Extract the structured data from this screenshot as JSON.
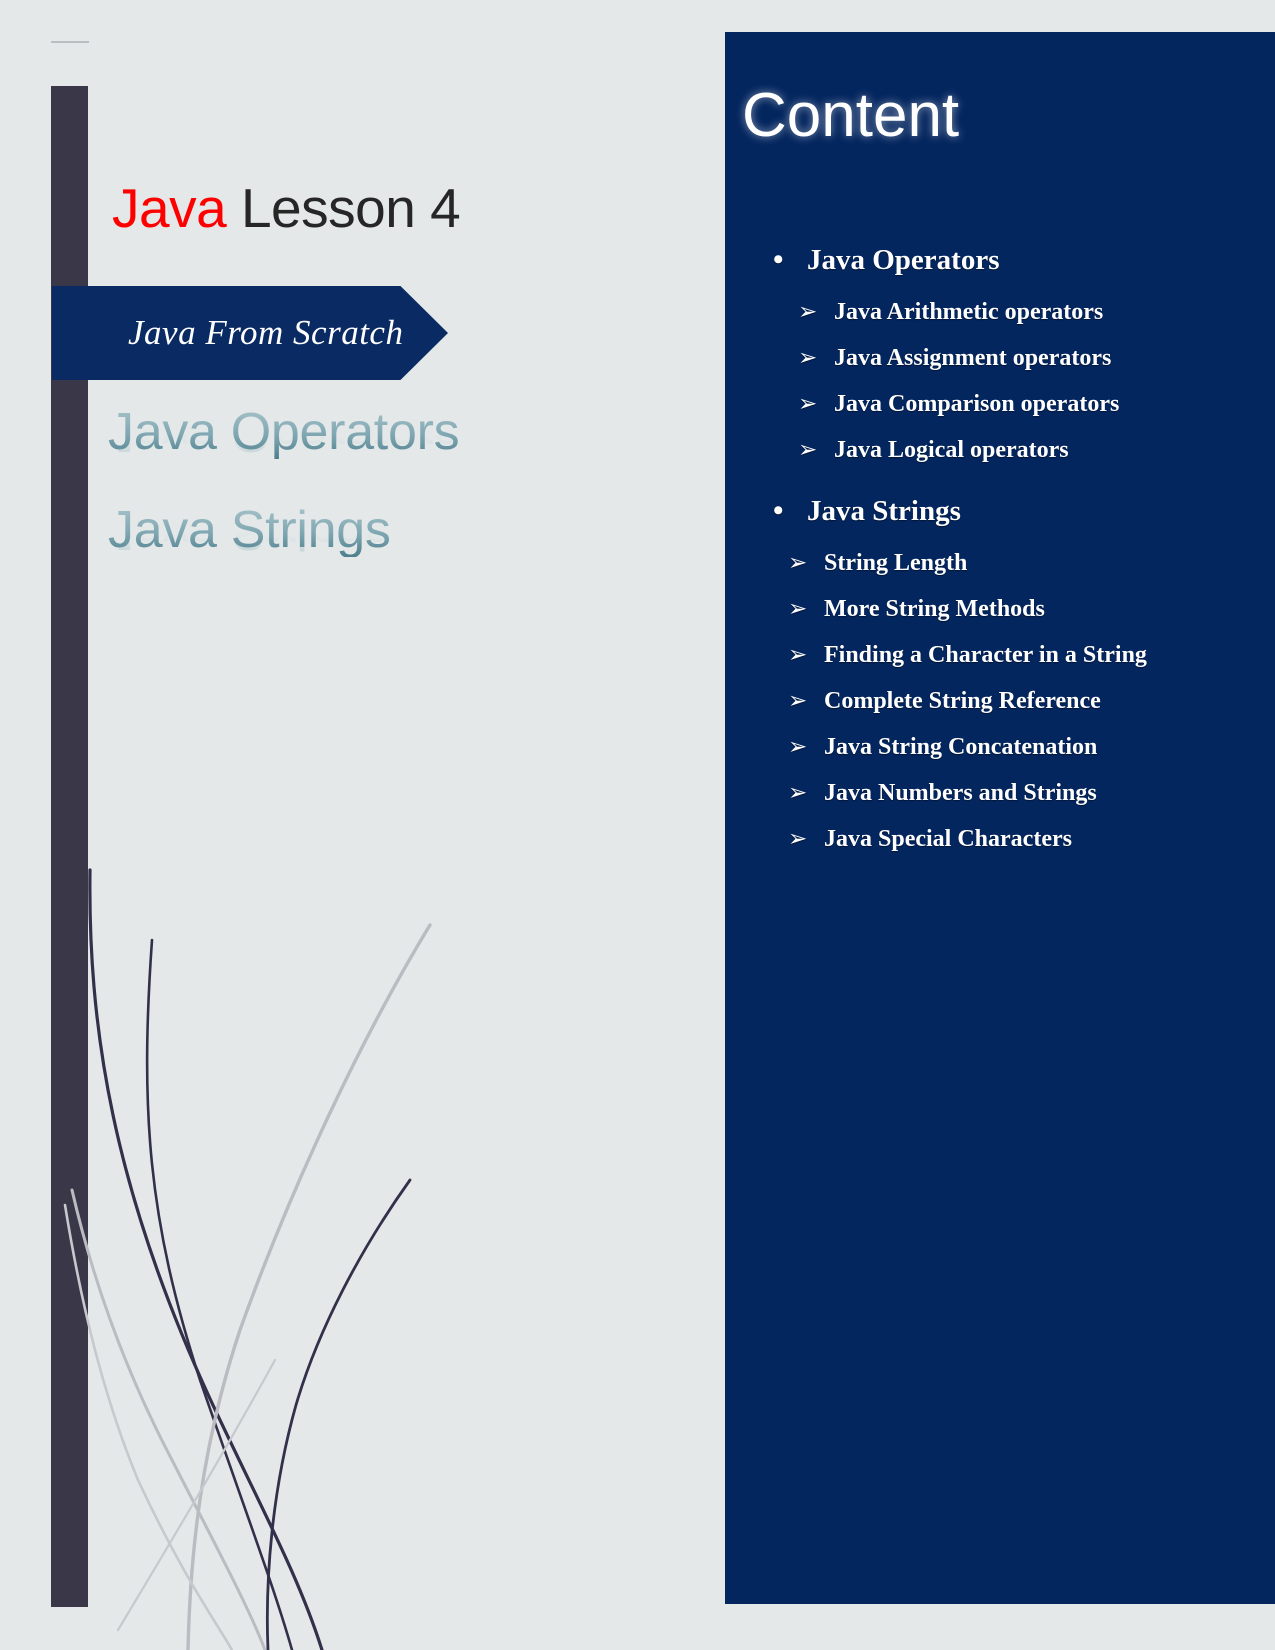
{
  "cover": {
    "title_accent": "Java",
    "title_rest": " Lesson 4",
    "banner_label": "Java From Scratch",
    "subtitle_lines": [
      "Java Operators",
      "Java Strings"
    ],
    "accent_color": "#ff0000",
    "bar_color": "#3a3748",
    "banner_color": "#0a2a63",
    "page_background": "#e4e8e8",
    "subtitle_gradient_from": "#a9c3ca",
    "subtitle_gradient_to": "#4d7f8c"
  },
  "content": {
    "heading": "Content",
    "panel_color": "#04265f",
    "text_color": "#ffffff",
    "bullet_glyph": "•",
    "arrow_glyph": "➢",
    "groups": [
      {
        "title": "Java Operators",
        "items": [
          "Java Arithmetic operators",
          "Java Assignment operators",
          "Java Comparison operators",
          "Java Logical operators"
        ]
      },
      {
        "title": "Java Strings",
        "items": [
          "String Length",
          "More String Methods",
          "Finding a Character in a String",
          "Complete String Reference",
          "Java String Concatenation",
          "Java Numbers and Strings",
          "Java Special Characters"
        ]
      }
    ]
  }
}
